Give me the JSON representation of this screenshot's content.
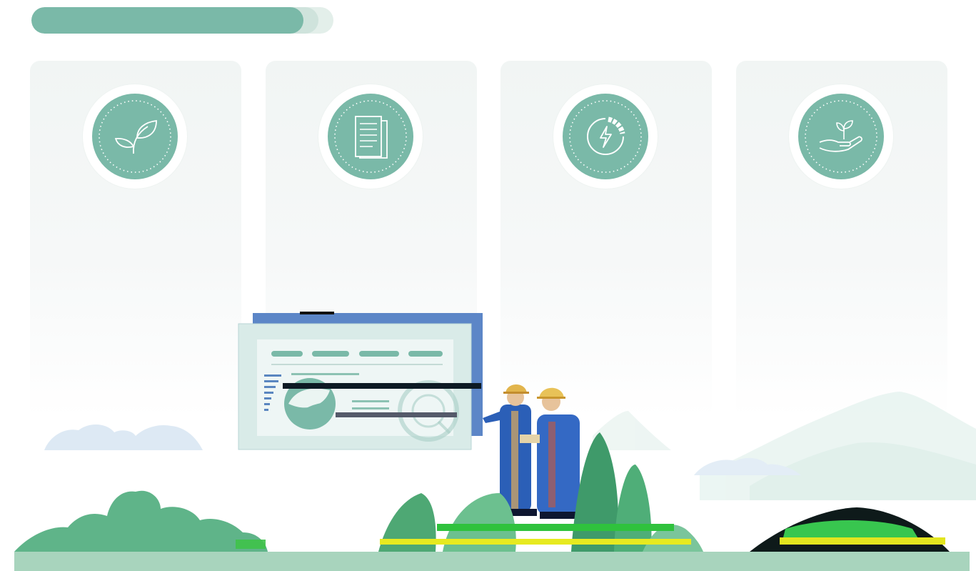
{
  "progress": {
    "fill_fraction": 0.9,
    "secondary_fraction": 0.95
  },
  "colors": {
    "accent": "#7ab9a8",
    "card_bg": "#f1f5f4",
    "ground": "#a8d4bd",
    "plant_dark": "#3f9a6a",
    "plant_light": "#6cc08f",
    "worker_blue": "#2b5fb7",
    "helmet": "#e2b54c"
  },
  "cards": [
    {
      "icon": "leaf-icon"
    },
    {
      "icon": "document-icon"
    },
    {
      "icon": "energy-cycle-icon"
    },
    {
      "icon": "hand-sprout-icon"
    }
  ]
}
